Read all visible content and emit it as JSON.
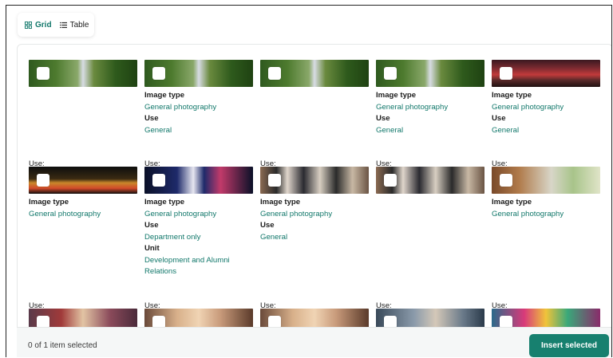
{
  "view_toggle": {
    "grid_label": "Grid",
    "table_label": "Table"
  },
  "labels": {
    "image_type": "Image type",
    "use": "Use",
    "unit": "Unit",
    "use_stub": "Use:"
  },
  "rows": [
    [
      {
        "thumb": "img-trees",
        "image_type": null,
        "use": null,
        "unit": null
      },
      {
        "thumb": "img-trees",
        "image_type": "General photography",
        "use": "General",
        "unit": null
      },
      {
        "thumb": "img-trees",
        "image_type": null,
        "use": null,
        "unit": null
      },
      {
        "thumb": "img-trees",
        "image_type": "General photography",
        "use": "General",
        "unit": null
      },
      {
        "thumb": "img-event",
        "image_type": "General photography",
        "use": "General",
        "unit": null
      }
    ],
    [
      {
        "thumb": "img-night",
        "image_type": "General photography",
        "use": null,
        "unit": null
      },
      {
        "thumb": "img-stage",
        "image_type": "General photography",
        "use": "Department only",
        "unit": "Development and Alumni Relations"
      },
      {
        "thumb": "img-group",
        "image_type": "General photography",
        "use": "General",
        "unit": null
      },
      {
        "thumb": "img-group",
        "image_type": null,
        "use": null,
        "unit": null
      },
      {
        "thumb": "img-portrait",
        "image_type": "General photography",
        "use": null,
        "unit": null
      }
    ],
    [
      {
        "thumb": "img-crowd",
        "image_type": null,
        "use": null,
        "unit": null
      },
      {
        "thumb": "img-faces",
        "image_type": null,
        "use": null,
        "unit": null
      },
      {
        "thumb": "img-faces",
        "image_type": null,
        "use": null,
        "unit": null
      },
      {
        "thumb": "img-class",
        "image_type": null,
        "use": null,
        "unit": null
      },
      {
        "thumb": "img-colorful",
        "image_type": null,
        "use": null,
        "unit": null
      }
    ]
  ],
  "footer": {
    "selection_count": "0 of 1 item selected",
    "insert_label": "Insert selected"
  },
  "colors": {
    "accent": "#12786b",
    "button": "#17806f"
  }
}
